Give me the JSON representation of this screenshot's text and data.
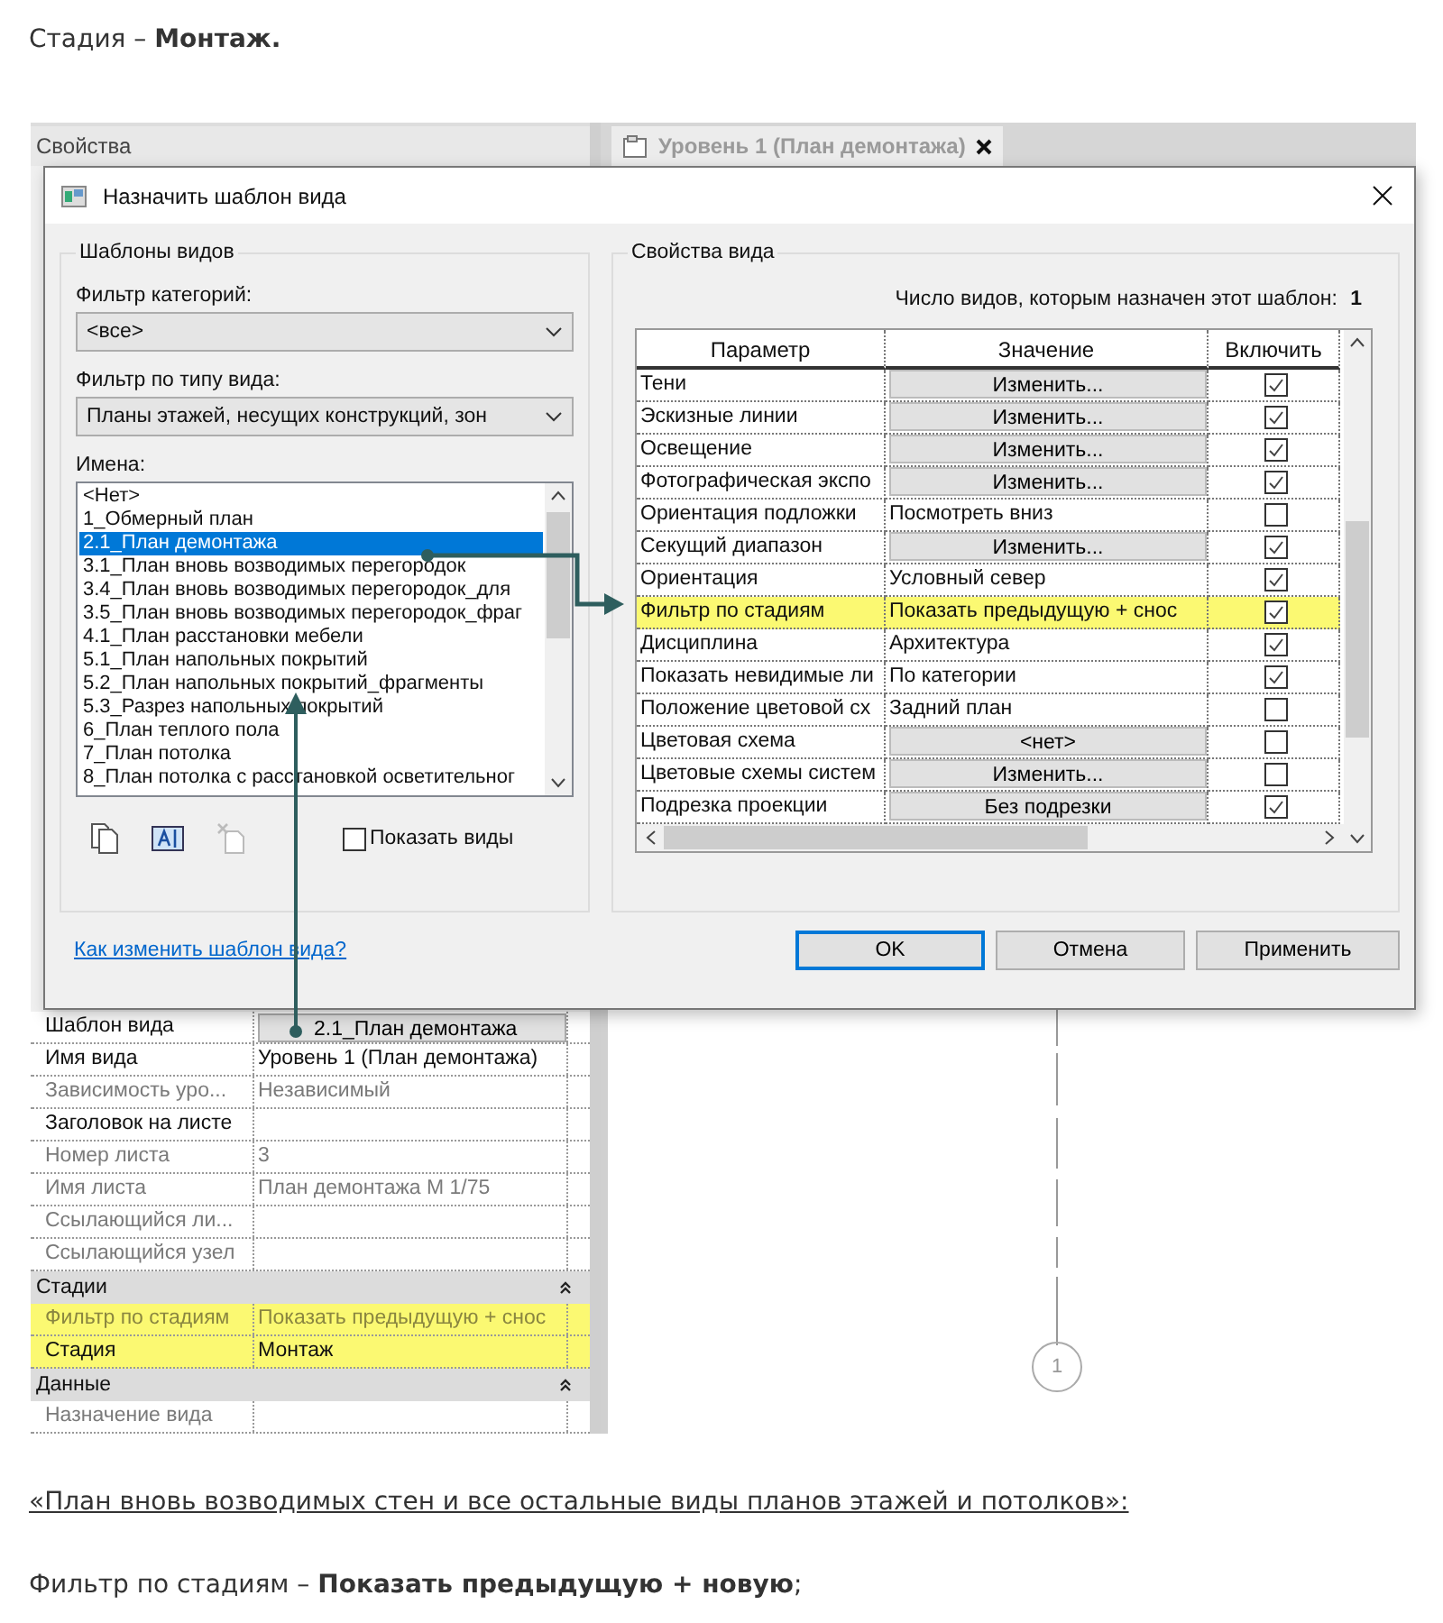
{
  "intro": "Стадия – **Монтаж.**",
  "properties_panel": {
    "title": "Свойства",
    "rows": [
      {
        "kind": "template_param",
        "name": "Шаблон вида",
        "value": "2.1_План демонтажа",
        "dimmed": false,
        "highlighted": false
      },
      {
        "kind": "param",
        "name": "Имя вида",
        "value": "Уровень 1 (План демонтажа)",
        "dimmed": false,
        "highlighted": false
      },
      {
        "kind": "param",
        "name": "Зависимость уро...",
        "value": "Независимый",
        "dimmed": true,
        "highlighted": false
      },
      {
        "kind": "param",
        "name": "Заголовок на листе",
        "dimmed": false,
        "highlighted": false
      },
      {
        "kind": "param",
        "name": "Номер листа",
        "value": "3",
        "dimmed": true,
        "highlighted": false
      },
      {
        "kind": "param",
        "name": "Имя листа",
        "value": "План демонтажа М 1/75",
        "dimmed": true,
        "highlighted": false
      },
      {
        "kind": "param",
        "name": "Ссылающийся ли...",
        "dimmed": true,
        "highlighted": false
      },
      {
        "kind": "param",
        "name": "Ссылающийся узел",
        "dimmed": true,
        "highlighted": false
      },
      {
        "kind": "group",
        "name": "Стадии",
        "expanded": true
      },
      {
        "kind": "param",
        "name": "Фильтр по стадиям",
        "value": "Показать предыдущую + снос",
        "dimmed": true,
        "highlighted": true
      },
      {
        "kind": "param",
        "name": "Стадия",
        "value": "Монтаж",
        "dimmed": false,
        "highlighted": true
      },
      {
        "kind": "group",
        "name": "Данные",
        "expanded": true
      },
      {
        "kind": "param",
        "name": "Назначение вида",
        "dimmed": true,
        "highlighted": false
      }
    ]
  },
  "view_tab": {
    "title": "Уровень 1 (План демонтажа)"
  },
  "grid_bubble": "1",
  "dialog": {
    "title": "Назначить шаблон вида",
    "templates": {
      "title": "Шаблоны видов",
      "category_filter": {
        "label": "Фильтр категорий:",
        "value": "<все>"
      },
      "type_filter": {
        "label": "Фильтр по типу вида:",
        "value": "Планы этажей, несущих конструкций, зон"
      },
      "names": {
        "label": "Имена:",
        "items": [
          {
            "text": "<Нет>",
            "selected": false
          },
          {
            "text": "1_Обмерный план",
            "selected": false
          },
          {
            "text": "2.1_План демонтажа",
            "selected": true
          },
          {
            "text": "3.1_План вновь возводимых перегородок",
            "selected": false
          },
          {
            "text": "3.4_План вновь возводимых перегородок_для",
            "selected": false
          },
          {
            "text": "3.5_План вновь возводимых перегородок_фраг",
            "selected": false
          },
          {
            "text": "4.1_План расстановки мебели",
            "selected": false
          },
          {
            "text": "5.1_План напольных покрытий",
            "selected": false
          },
          {
            "text": "5.2_План напольных покрытий_фрагменты",
            "selected": false
          },
          {
            "text": "5.3_Разрез напольных покрытий",
            "selected": false
          },
          {
            "text": "6_План теплого пола",
            "selected": false
          },
          {
            "text": "7_План потолка",
            "selected": false
          },
          {
            "text": "8_План потолка с расстановкой осветительног",
            "selected": false
          }
        ]
      },
      "show_views": {
        "label": "Показать виды",
        "checked": false
      }
    },
    "view_properties": {
      "title": "Свойства вида",
      "count_label": "Число видов, которым назначен этот шаблон:",
      "count": "1",
      "columns": [
        "Параметр",
        "Значение",
        "Включить"
      ],
      "rows": [
        {
          "param": "Тени",
          "value": "Изменить...",
          "kind": "button",
          "include": true,
          "highlighted": false
        },
        {
          "param": "Эскизные линии",
          "value": "Изменить...",
          "kind": "button",
          "include": true,
          "highlighted": false
        },
        {
          "param": "Освещение",
          "value": "Изменить...",
          "kind": "button",
          "include": true,
          "highlighted": false
        },
        {
          "param": "Фотографическая экспо",
          "value": "Изменить...",
          "kind": "button",
          "include": true,
          "highlighted": false
        },
        {
          "param": "Ориентация подложки",
          "value": "Посмотреть вниз",
          "kind": "text",
          "include": false,
          "highlighted": false
        },
        {
          "param": "Секущий диапазон",
          "value": "Изменить...",
          "kind": "button",
          "include": true,
          "highlighted": false
        },
        {
          "param": "Ориентация",
          "value": "Условный север",
          "kind": "text",
          "include": true,
          "highlighted": false
        },
        {
          "param": "Фильтр по стадиям",
          "value": "Показать предыдущую + снос",
          "kind": "text",
          "include": true,
          "highlighted": true
        },
        {
          "param": "Дисциплина",
          "value": "Архитектура",
          "kind": "text",
          "include": true,
          "highlighted": false
        },
        {
          "param": "Показать невидимые ли",
          "value": "По категории",
          "kind": "text",
          "include": true,
          "highlighted": false
        },
        {
          "param": "Положение цветовой сх",
          "value": "Задний план",
          "kind": "text",
          "include": false,
          "highlighted": false
        },
        {
          "param": "Цветовая схема",
          "value": "<нет>",
          "kind": "button",
          "include": false,
          "highlighted": false
        },
        {
          "param": "Цветовые схемы систем",
          "value": "Изменить...",
          "kind": "button",
          "include": false,
          "highlighted": false
        },
        {
          "param": "Подрезка проекции",
          "value": "Без подрезки",
          "kind": "button",
          "include": true,
          "highlighted": false
        }
      ]
    },
    "help_link": "Как изменить шаблон вида?",
    "buttons": [
      {
        "label": "OK",
        "default": true
      },
      {
        "label": "Отмена",
        "default": false
      },
      {
        "label": "Применить",
        "default": false
      }
    ]
  },
  "link_paragraph": "«План вновь возводимых стен и все остальные виды планов этажей и потолков»:",
  "outro": "Фильтр по стадиям – **Показать предыдущую + новую**;"
}
